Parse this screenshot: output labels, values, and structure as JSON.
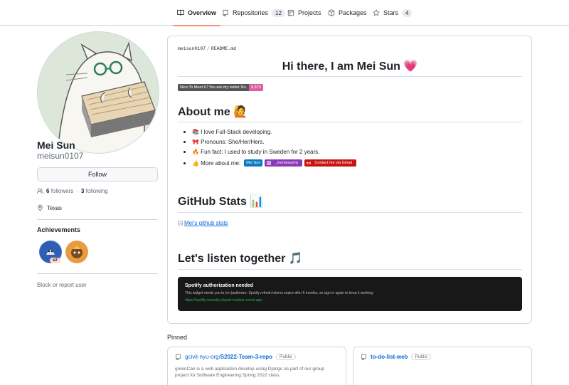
{
  "tabs": [
    {
      "label": "Overview",
      "icon": "book-icon",
      "active": true
    },
    {
      "label": "Repositories",
      "icon": "repo-icon",
      "count": "12"
    },
    {
      "label": "Projects",
      "icon": "table-icon"
    },
    {
      "label": "Packages",
      "icon": "package-icon"
    },
    {
      "label": "Stars",
      "icon": "star-icon",
      "count": "4"
    }
  ],
  "profile": {
    "name": "Mei Sun",
    "login": "meisun0107",
    "follow_label": "Follow",
    "followers_count": "6",
    "followers_label": "followers",
    "separator": "·",
    "following_count": "3",
    "following_label": "following",
    "location": "Texas",
    "achievements_title": "Achievements",
    "achievement_multiplier": "x2",
    "block_label": "Block or report user"
  },
  "readme": {
    "path_user": "meisun0107",
    "path_sep": "/",
    "path_file": "README.md",
    "heading": "Hi there, I am Mei Sun 💗",
    "visitor_badge_label": "Nice To Meet U! You are my visitor No.",
    "visitor_badge_value": "6,373",
    "about_heading": "About me 🙋",
    "about_items": [
      "📚 I love Full-Stack developing.",
      "🎀 Pronouns: She/Her/Hers.",
      "🔥 Fun fact: I used to study in Sweden for 2 years.",
      "👍 More about me:"
    ],
    "more_badges": [
      "Mei Sun",
      "_momosunny",
      "Contact me via Gmail"
    ],
    "stats_heading": "GitHub Stats 📊",
    "stats_alt": "Mei's github stats",
    "listen_heading": "Let's listen together 🎵",
    "spotify_title": "Spotify authorization needed",
    "spotify_text": "This widget needs you to (re-)authorize. Spotify refresh tokens expire after 6 months, so sign in again to keep it working:",
    "spotify_link": "https://spotify-recently-played-readme.vercel.app"
  },
  "pinned": {
    "title": "Pinned",
    "cards": [
      {
        "owner": "gcivil-nyu-org/",
        "repo": "S2022-Team-3-repo",
        "visibility": "Public",
        "description": "greenCan is a web application develop using Django as part of our group project for Software Engineering Spring 2022 class."
      },
      {
        "owner": "",
        "repo": "to-do-list-web",
        "visibility": "Public",
        "description": ""
      }
    ]
  },
  "colors": {
    "accent_tab": "#fd8c73",
    "link": "#0969da",
    "badge_pink": "#e05d9e",
    "badge_blue": "#0a7bbb",
    "badge_purple": "#8a3ab9",
    "badge_red": "#c71610",
    "spotify_bg": "#181818"
  }
}
